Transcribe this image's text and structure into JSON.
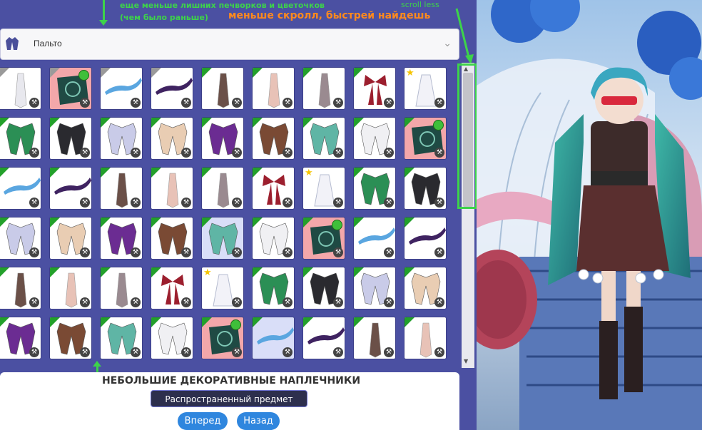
{
  "annotations": {
    "top_line1": "еще меньше лишних печворков и цветочков",
    "top_line2": "(чем было раньше)",
    "orange": "меньше скролл, быстрей найдешь",
    "scroll_less": "scroll less"
  },
  "dropdown": {
    "category_label": "Пальто",
    "category_icon": "coat-icon",
    "chevron_icon": "chevron-down-icon"
  },
  "grid": {
    "items": [
      {
        "kind": "white-ribbon",
        "bg": "white",
        "tri": "grey",
        "wrench": true
      },
      {
        "kind": "patchwork",
        "bg": "pink",
        "tri": "grey",
        "wrench": true,
        "gem": true
      },
      {
        "kind": "blue-pauldron",
        "bg": "white",
        "tri": "grey",
        "wrench": true
      },
      {
        "kind": "purple-pauldron",
        "bg": "white",
        "tri": "grey",
        "wrench": true
      },
      {
        "kind": "brown-ribbon",
        "bg": "white",
        "tri": "green",
        "wrench": true
      },
      {
        "kind": "pink-ribbon",
        "bg": "white",
        "tri": "green",
        "wrench": true
      },
      {
        "kind": "taupe-ribbon",
        "bg": "white",
        "tri": "green",
        "wrench": true
      },
      {
        "kind": "red-bow",
        "bg": "white",
        "tri": "green",
        "wrench": true
      },
      {
        "kind": "white-flower",
        "bg": "white",
        "tri": "none",
        "wrench": true,
        "star": true
      },
      {
        "kind": "green-cape",
        "bg": "white",
        "tri": "green",
        "wrench": true
      },
      {
        "kind": "black-cape",
        "bg": "white",
        "tri": "green",
        "wrench": true
      },
      {
        "kind": "lavender-cape",
        "bg": "white",
        "tri": "green",
        "wrench": true
      },
      {
        "kind": "beige-cape",
        "bg": "white",
        "tri": "green",
        "wrench": true
      },
      {
        "kind": "purple-cape",
        "bg": "white",
        "tri": "green",
        "wrench": true
      },
      {
        "kind": "brown-cape",
        "bg": "white",
        "tri": "green",
        "wrench": true
      },
      {
        "kind": "teal-cape",
        "bg": "white",
        "tri": "green",
        "wrench": true
      },
      {
        "kind": "white-cape",
        "bg": "white",
        "tri": "green",
        "wrench": true
      },
      {
        "kind": "patchwork",
        "bg": "pink",
        "tri": "green",
        "wrench": true,
        "gem": true
      },
      {
        "kind": "blue-pauldron",
        "bg": "white",
        "tri": "green",
        "wrench": true
      },
      {
        "kind": "purple-pauldron",
        "bg": "white",
        "tri": "green",
        "wrench": true
      },
      {
        "kind": "brown-ribbon",
        "bg": "white",
        "tri": "green",
        "wrench": true
      },
      {
        "kind": "pink-ribbon",
        "bg": "white",
        "tri": "green",
        "wrench": true
      },
      {
        "kind": "taupe-ribbon",
        "bg": "white",
        "tri": "green",
        "wrench": true
      },
      {
        "kind": "red-bow",
        "bg": "white",
        "tri": "green",
        "wrench": true
      },
      {
        "kind": "white-flower",
        "bg": "white",
        "tri": "none",
        "wrench": true,
        "star": true
      },
      {
        "kind": "green-cape",
        "bg": "white",
        "tri": "green",
        "wrench": true
      },
      {
        "kind": "black-cape",
        "bg": "white",
        "tri": "green",
        "wrench": true
      },
      {
        "kind": "lavender-cape",
        "bg": "white",
        "tri": "green",
        "wrench": true
      },
      {
        "kind": "beige-cape",
        "bg": "white",
        "tri": "green",
        "wrench": true
      },
      {
        "kind": "purple-cape",
        "bg": "white",
        "tri": "green",
        "wrench": true
      },
      {
        "kind": "brown-cape",
        "bg": "white",
        "tri": "green",
        "wrench": true
      },
      {
        "kind": "teal-cape",
        "bg": "blue",
        "tri": "green",
        "wrench": true
      },
      {
        "kind": "white-cape",
        "bg": "white",
        "tri": "green",
        "wrench": true
      },
      {
        "kind": "patchwork",
        "bg": "pink",
        "tri": "green",
        "wrench": true,
        "gem": true
      },
      {
        "kind": "blue-pauldron",
        "bg": "white",
        "tri": "green",
        "wrench": true
      },
      {
        "kind": "purple-pauldron",
        "bg": "white",
        "tri": "green",
        "wrench": true
      },
      {
        "kind": "brown-ribbon",
        "bg": "white",
        "tri": "green",
        "wrench": true
      },
      {
        "kind": "pink-ribbon",
        "bg": "white",
        "tri": "green",
        "wrench": true
      },
      {
        "kind": "taupe-ribbon",
        "bg": "white",
        "tri": "green",
        "wrench": true
      },
      {
        "kind": "red-bow",
        "bg": "white",
        "tri": "green",
        "wrench": true
      },
      {
        "kind": "white-flower",
        "bg": "white",
        "tri": "none",
        "wrench": true,
        "star": true
      },
      {
        "kind": "green-cape",
        "bg": "white",
        "tri": "green",
        "wrench": true
      },
      {
        "kind": "black-cape",
        "bg": "white",
        "tri": "green",
        "wrench": true
      },
      {
        "kind": "lavender-cape",
        "bg": "white",
        "tri": "green",
        "wrench": true
      },
      {
        "kind": "beige-cape",
        "bg": "white",
        "tri": "green",
        "wrench": true
      },
      {
        "kind": "purple-cape",
        "bg": "white",
        "tri": "green",
        "wrench": true
      },
      {
        "kind": "brown-cape",
        "bg": "white",
        "tri": "green",
        "wrench": true
      },
      {
        "kind": "teal-cape",
        "bg": "white",
        "tri": "green",
        "wrench": true
      },
      {
        "kind": "white-cape",
        "bg": "white",
        "tri": "green",
        "wrench": true
      },
      {
        "kind": "patchwork",
        "bg": "pink",
        "tri": "green",
        "wrench": true,
        "gem": true
      },
      {
        "kind": "blue-pauldron",
        "bg": "blue",
        "tri": "green",
        "wrench": true
      },
      {
        "kind": "purple-pauldron",
        "bg": "white",
        "tri": "green",
        "wrench": true
      },
      {
        "kind": "brown-ribbon",
        "bg": "white",
        "tri": "green",
        "wrench": true
      },
      {
        "kind": "pink-ribbon",
        "bg": "white",
        "tri": "green",
        "wrench": true
      }
    ]
  },
  "info": {
    "item_name": "НЕБОЛЬШИЕ ДЕКОРАТИВНЫЕ НАПЛЕЧНИКИ",
    "rarity": "Распространенный предмет",
    "next_button": "Вперед",
    "back_button": "Назад"
  },
  "colors": {
    "annotation_green": "#3dd34a",
    "annotation_orange": "#ff8a1d",
    "panel_bg": "#4b50a2",
    "button_blue": "#2f86de",
    "rarity_bg": "#2d2f4d"
  }
}
